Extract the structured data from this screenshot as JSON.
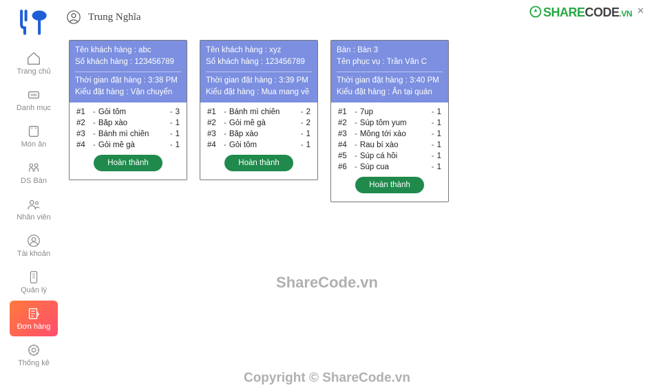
{
  "header": {
    "user_name": "Trung Nghĩa"
  },
  "sidebar": {
    "items": [
      {
        "label": "Trang chủ"
      },
      {
        "label": "Danh mục"
      },
      {
        "label": "Món ăn"
      },
      {
        "label": "DS Bàn"
      },
      {
        "label": "Nhân viên"
      },
      {
        "label": "Tài khoản"
      },
      {
        "label": "Quản lý"
      },
      {
        "label": "Đơn hàng"
      },
      {
        "label": "Thống kê"
      }
    ],
    "active_index": 7
  },
  "orders": [
    {
      "header_line1_label": "Tên khách hàng :",
      "header_line1_value": "abc",
      "header_line2_label": "Số khách hàng :",
      "header_line2_value": "123456789",
      "time_label": "Thời gian đặt hàng :",
      "time_value": "3:38 PM",
      "type_label": "Kiểu đặt hàng :",
      "type_value": "Vận chuyển",
      "items": [
        {
          "idx": "#1",
          "name": "Gỏi tôm",
          "qty": "3"
        },
        {
          "idx": "#2",
          "name": "Bắp xào",
          "qty": "1"
        },
        {
          "idx": "#3",
          "name": "Bánh mì chiên",
          "qty": "1"
        },
        {
          "idx": "#4",
          "name": "Gỏi mề gà",
          "qty": "1"
        }
      ],
      "button": "Hoàn thành"
    },
    {
      "header_line1_label": "Tên khách hàng :",
      "header_line1_value": "xyz",
      "header_line2_label": "Số khách hàng :",
      "header_line2_value": "123456789",
      "time_label": "Thời gian đặt hàng :",
      "time_value": "3:39 PM",
      "type_label": "Kiểu đặt hàng :",
      "type_value": "Mua mang về",
      "items": [
        {
          "idx": "#1",
          "name": "Bánh mì chiên",
          "qty": "2"
        },
        {
          "idx": "#2",
          "name": "Gỏi mề gà",
          "qty": "2"
        },
        {
          "idx": "#3",
          "name": "Bắp xào",
          "qty": "1"
        },
        {
          "idx": "#4",
          "name": "Gỏi tôm",
          "qty": "1"
        }
      ],
      "button": "Hoàn thành"
    },
    {
      "header_line1_label": "Bàn :",
      "header_line1_value": "Bàn 3",
      "header_line2_label": "Tên phục vụ :",
      "header_line2_value": "Trần Văn C",
      "time_label": "Thời gian đặt hàng :",
      "time_value": "3:40 PM",
      "type_label": "Kiểu đặt hàng :",
      "type_value": "Ăn tại quán",
      "items": [
        {
          "idx": "#1",
          "name": "7up",
          "qty": "1"
        },
        {
          "idx": "#2",
          "name": "Súp tôm yum",
          "qty": "1"
        },
        {
          "idx": "#3",
          "name": "Mồng tới xào",
          "qty": "1"
        },
        {
          "idx": "#4",
          "name": "Rau bí xào",
          "qty": "1"
        },
        {
          "idx": "#5",
          "name": "Súp cá hồi",
          "qty": "1"
        },
        {
          "idx": "#6",
          "name": "Súp cua",
          "qty": "1"
        }
      ],
      "button": "Hoàn thành"
    }
  ],
  "watermark": {
    "brand_part1": "SHARE",
    "brand_part2": "CODE",
    "brand_suffix": ".VN",
    "center": "ShareCode.vn",
    "copyright": "Copyright © ShareCode.vn"
  }
}
